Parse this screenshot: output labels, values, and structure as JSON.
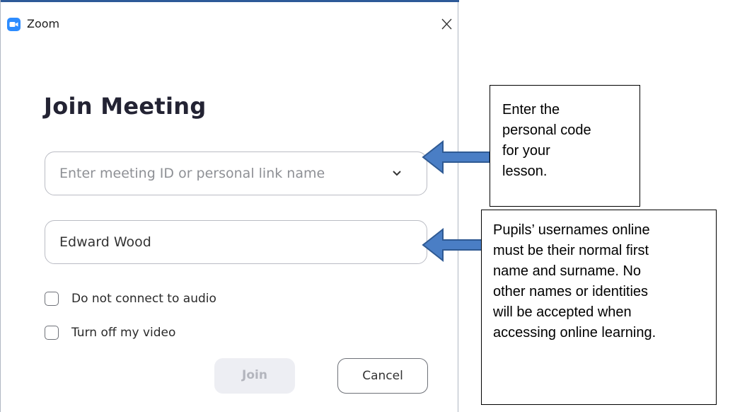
{
  "window": {
    "title": "Zoom",
    "app_icon": "zoom-camera-icon",
    "close_icon": "close-icon"
  },
  "dialog": {
    "heading": "Join Meeting",
    "meeting_id_input": {
      "placeholder": "Enter meeting ID or personal link name",
      "value": "",
      "dropdown_icon": "chevron-down-icon"
    },
    "name_input": {
      "value": "Edward Wood"
    },
    "options": [
      {
        "label": "Do not connect to audio",
        "checked": false
      },
      {
        "label": "Turn off my video",
        "checked": false
      }
    ],
    "buttons": {
      "join": "Join",
      "cancel": "Cancel"
    }
  },
  "annotations": {
    "meeting_code_note": [
      "Enter the",
      "personal code",
      "for your",
      "lesson."
    ],
    "username_note": [
      "Pupils’ usernames online",
      "must be their normal first",
      "name and surname. No",
      "other names or identities",
      "will be accepted when",
      "accessing online learning."
    ]
  },
  "colors": {
    "zoom_blue": "#2d8cff",
    "arrow_blue": "#4a7ec5",
    "arrow_outline": "#2f5a93",
    "heading_text": "#232333",
    "disabled_button_bg": "#edeef3"
  }
}
